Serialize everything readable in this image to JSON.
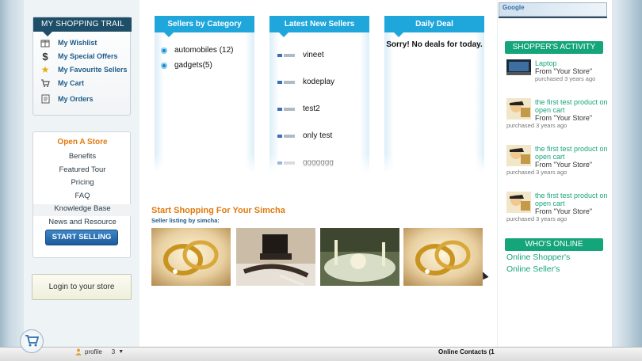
{
  "trail": {
    "title": "MY SHOPPING TRAIL",
    "items": [
      {
        "label": "My Wishlist",
        "icon": "gift-icon"
      },
      {
        "label": "My Special Offers",
        "icon": "dollar-icon"
      },
      {
        "label": "My Favourite Sellers",
        "icon": "star-icon"
      },
      {
        "label": "My Cart",
        "icon": "cart-icon"
      },
      {
        "label": "My Orders",
        "icon": "document-icon"
      }
    ]
  },
  "store": {
    "title": "Open A Store",
    "links": [
      "Benefits",
      "Featured Tour",
      "Pricing",
      "FAQ",
      "Knowledge Base",
      "News and Resource"
    ],
    "cta": "START SELLING"
  },
  "login": {
    "label": "Login to your store"
  },
  "categories": {
    "title": "Sellers by Category",
    "items": [
      "automobiles (12)",
      "gadgets(5)"
    ]
  },
  "new_sellers": {
    "title": "Latest New Sellers",
    "items": [
      "vineet",
      "kodeplay",
      "test2",
      "only test",
      "ggggggg"
    ]
  },
  "deal": {
    "title": "Daily Deal",
    "text": "Sorry! No deals for today."
  },
  "simcha": {
    "title": "Start Shopping For Your Simcha",
    "subtitle": "Seller listing by simcha:"
  },
  "ad": {
    "label": "Google"
  },
  "activity": {
    "title": "SHOPPER'S ACTIVITY",
    "items": [
      {
        "product": "Laptop",
        "from": "From \"Your Store\"",
        "time": "purchased 3 years ago"
      },
      {
        "product": "the first test product on open cart",
        "from": "From \"Your Store\"",
        "time": "purchased 3 years ago"
      },
      {
        "product": "the first test product on open cart",
        "from": "From \"Your Store\"",
        "time": "purchased 3 years ago"
      },
      {
        "product": "the first test product on open cart",
        "from": "From \"Your Store\"",
        "time": "purchased 3 years ago"
      }
    ]
  },
  "online": {
    "title": "WHO'S ONLINE",
    "shoppers": "Online Shopper's",
    "sellers": "Online Seller's"
  },
  "bottom": {
    "profile_label": "profile",
    "profile_count": "3",
    "contacts_label": "Online Contacts (",
    "contacts_count": "1"
  }
}
